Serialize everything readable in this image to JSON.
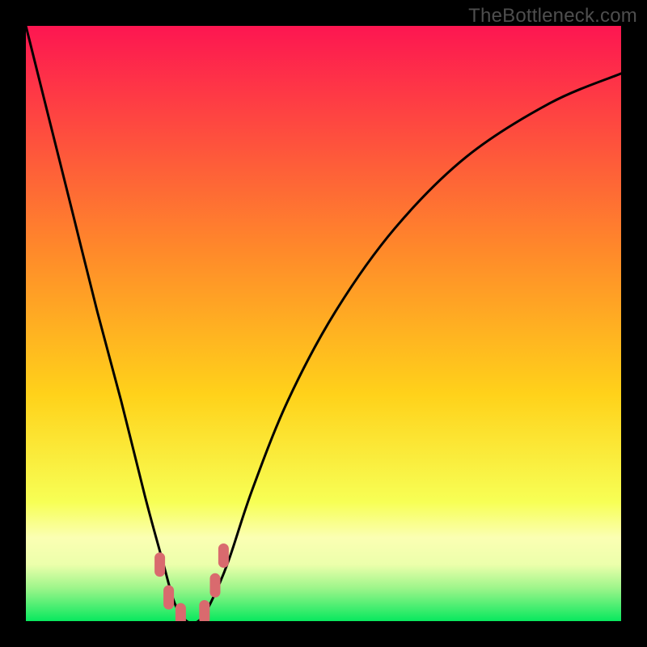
{
  "watermark": "TheBottleneck.com",
  "colors": {
    "frame": "#000000",
    "grad_top": "#fd1651",
    "grad_mid1": "#ff6f2f",
    "grad_mid2": "#ffcf1a",
    "grad_band": "#fcff99",
    "grad_bottom": "#08e85e",
    "curve": "#000000",
    "marker_fill": "#d96a6e",
    "marker_stroke": "#d96a6e"
  },
  "chart_data": {
    "type": "line",
    "title": "",
    "xlabel": "",
    "ylabel": "",
    "xlim": [
      0,
      100
    ],
    "ylim": [
      0,
      100
    ],
    "note": "Values estimated from pixel positions; y=0 is the bottom edge (green), y≈100 is the top (red). The curve depicts bottleneck percentage dipping to 0 near x≈27 then rising.",
    "series": [
      {
        "name": "bottleneck-curve",
        "x": [
          0,
          4,
          8,
          12,
          16,
          20,
          23,
          25,
          27,
          29,
          31,
          34,
          38,
          44,
          52,
          62,
          74,
          88,
          100
        ],
        "y": [
          100,
          84,
          68,
          52,
          37,
          21,
          10,
          3,
          0,
          0,
          3,
          10,
          22,
          37,
          52,
          66,
          78,
          87,
          92
        ]
      }
    ],
    "markers": [
      {
        "x": 22.5,
        "y": 9.5
      },
      {
        "x": 24.0,
        "y": 4.0
      },
      {
        "x": 26.0,
        "y": 1.0
      },
      {
        "x": 30.0,
        "y": 1.5
      },
      {
        "x": 31.8,
        "y": 6.0
      },
      {
        "x": 33.2,
        "y": 11.0
      }
    ],
    "gradient_stops": [
      {
        "offset": 0.0,
        "color": "#fd1651"
      },
      {
        "offset": 0.38,
        "color": "#ff8a2a"
      },
      {
        "offset": 0.62,
        "color": "#ffd21a"
      },
      {
        "offset": 0.8,
        "color": "#f7ff55"
      },
      {
        "offset": 0.86,
        "color": "#fbffb3"
      },
      {
        "offset": 0.905,
        "color": "#ecffab"
      },
      {
        "offset": 0.945,
        "color": "#9cf58a"
      },
      {
        "offset": 1.0,
        "color": "#08e85e"
      }
    ]
  }
}
